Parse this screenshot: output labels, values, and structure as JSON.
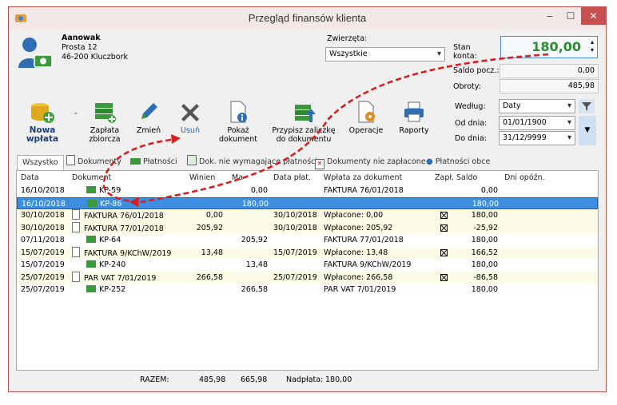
{
  "window": {
    "title": "Przegląd finansów klienta",
    "min": "‒",
    "max": "☐",
    "close": "✕"
  },
  "client": {
    "name": "Aanowak",
    "street": "Prosta 12",
    "city": "46-200 Kluczbork"
  },
  "animals": {
    "label": "Zwierzęta:",
    "value": "Wszystkie"
  },
  "balance": {
    "label": "Stan konta:",
    "value": "180,00",
    "value_color": "#2e8b2e",
    "opening_label": "Saldo pocz.:",
    "opening": "0,00",
    "turnover_label": "Obroty:",
    "turnover": "485,98"
  },
  "toolbar": {
    "new_payment": "Nowa wpłata",
    "collective_payment": "Zapłata zbiorcza",
    "edit": "Zmień",
    "delete": "Usuń",
    "show_document": "Pokaż dokument",
    "assign_advance": "Przypisz zaliczkę do dokumentu",
    "operations": "Operacje",
    "reports": "Raporty"
  },
  "filters": {
    "by_label": "Według:",
    "by_value": "Daty",
    "from_label": "Od dnia:",
    "from_value": "01/01/1900",
    "to_label": "Do dnia:",
    "to_value": "31/12/9999"
  },
  "tabs": [
    "Wszystko",
    "Dokumenty",
    "Płatności",
    "Dok. nie wymagające płatności",
    "Dokumenty nie zapłacone",
    "Płatności obce"
  ],
  "table": {
    "columns": [
      "Data",
      "Dokument",
      "Winien",
      "Ma",
      "Data płat.",
      "Wpłata za dokument",
      "Zapł.",
      "Saldo",
      "Dni opóźn."
    ],
    "rows": [
      {
        "date": "16/10/2018",
        "doc": "KP-59",
        "owes": "",
        "has": "0,00",
        "paydate": "",
        "paidfor": "FAKTURA 76/01/2018",
        "paid": false,
        "balance": "0,00",
        "delay": "",
        "kind": "payment",
        "style": ""
      },
      {
        "date": "16/10/2018",
        "doc": "KP-86",
        "owes": "",
        "has": "180,00",
        "paydate": "",
        "paidfor": "",
        "paid": false,
        "balance": "180,00",
        "delay": "",
        "kind": "payment",
        "style": "selected"
      },
      {
        "date": "30/10/2018",
        "doc": "FAKTURA 76/01/2018",
        "owes": "0,00",
        "has": "",
        "paydate": "30/10/2018",
        "paidfor": "Wpłacone: 0,00",
        "paid": true,
        "balance": "180,00",
        "delay": "",
        "kind": "document",
        "style": "yellow"
      },
      {
        "date": "30/10/2018",
        "doc": "FAKTURA 77/01/2018",
        "owes": "205,92",
        "has": "",
        "paydate": "30/10/2018",
        "paidfor": "Wpłacone: 205,92",
        "paid": true,
        "balance": "-25,92",
        "delay": "",
        "kind": "document",
        "style": "yellow"
      },
      {
        "date": "07/11/2018",
        "doc": "KP-64",
        "owes": "",
        "has": "205,92",
        "paydate": "",
        "paidfor": "FAKTURA 77/01/2018",
        "paid": false,
        "balance": "180,00",
        "delay": "",
        "kind": "payment",
        "style": ""
      },
      {
        "date": "15/07/2019",
        "doc": "FAKTURA 9/KChW/2019",
        "owes": "13,48",
        "has": "",
        "paydate": "15/07/2019",
        "paidfor": "Wpłacone: 13,48",
        "paid": true,
        "balance": "166,52",
        "delay": "",
        "kind": "document",
        "style": "yellow"
      },
      {
        "date": "15/07/2019",
        "doc": "KP-240",
        "owes": "",
        "has": "13,48",
        "paydate": "",
        "paidfor": "FAKTURA 9/KChW/2019",
        "paid": false,
        "balance": "180,00",
        "delay": "",
        "kind": "payment",
        "style": ""
      },
      {
        "date": "25/07/2019",
        "doc": "PAR VAT 7/01/2019",
        "owes": "266,58",
        "has": "",
        "paydate": "25/07/2019",
        "paidfor": "Wpłacone: 266,58",
        "paid": true,
        "balance": "-86,58",
        "delay": "",
        "kind": "document",
        "style": "yellow"
      },
      {
        "date": "25/07/2019",
        "doc": "KP-252",
        "owes": "",
        "has": "266,58",
        "paydate": "",
        "paidfor": "PAR VAT 7/01/2019",
        "paid": false,
        "balance": "180,00",
        "delay": "",
        "kind": "payment",
        "style": ""
      }
    ]
  },
  "footer": {
    "total_label": "RAZEM:",
    "total_owes": "485,98",
    "total_has": "665,98",
    "overpay_label": "Nadpłata:",
    "overpay": "180,00"
  },
  "colors": {
    "arrow": "#d81e1e",
    "selection": "#3d8ee0"
  }
}
